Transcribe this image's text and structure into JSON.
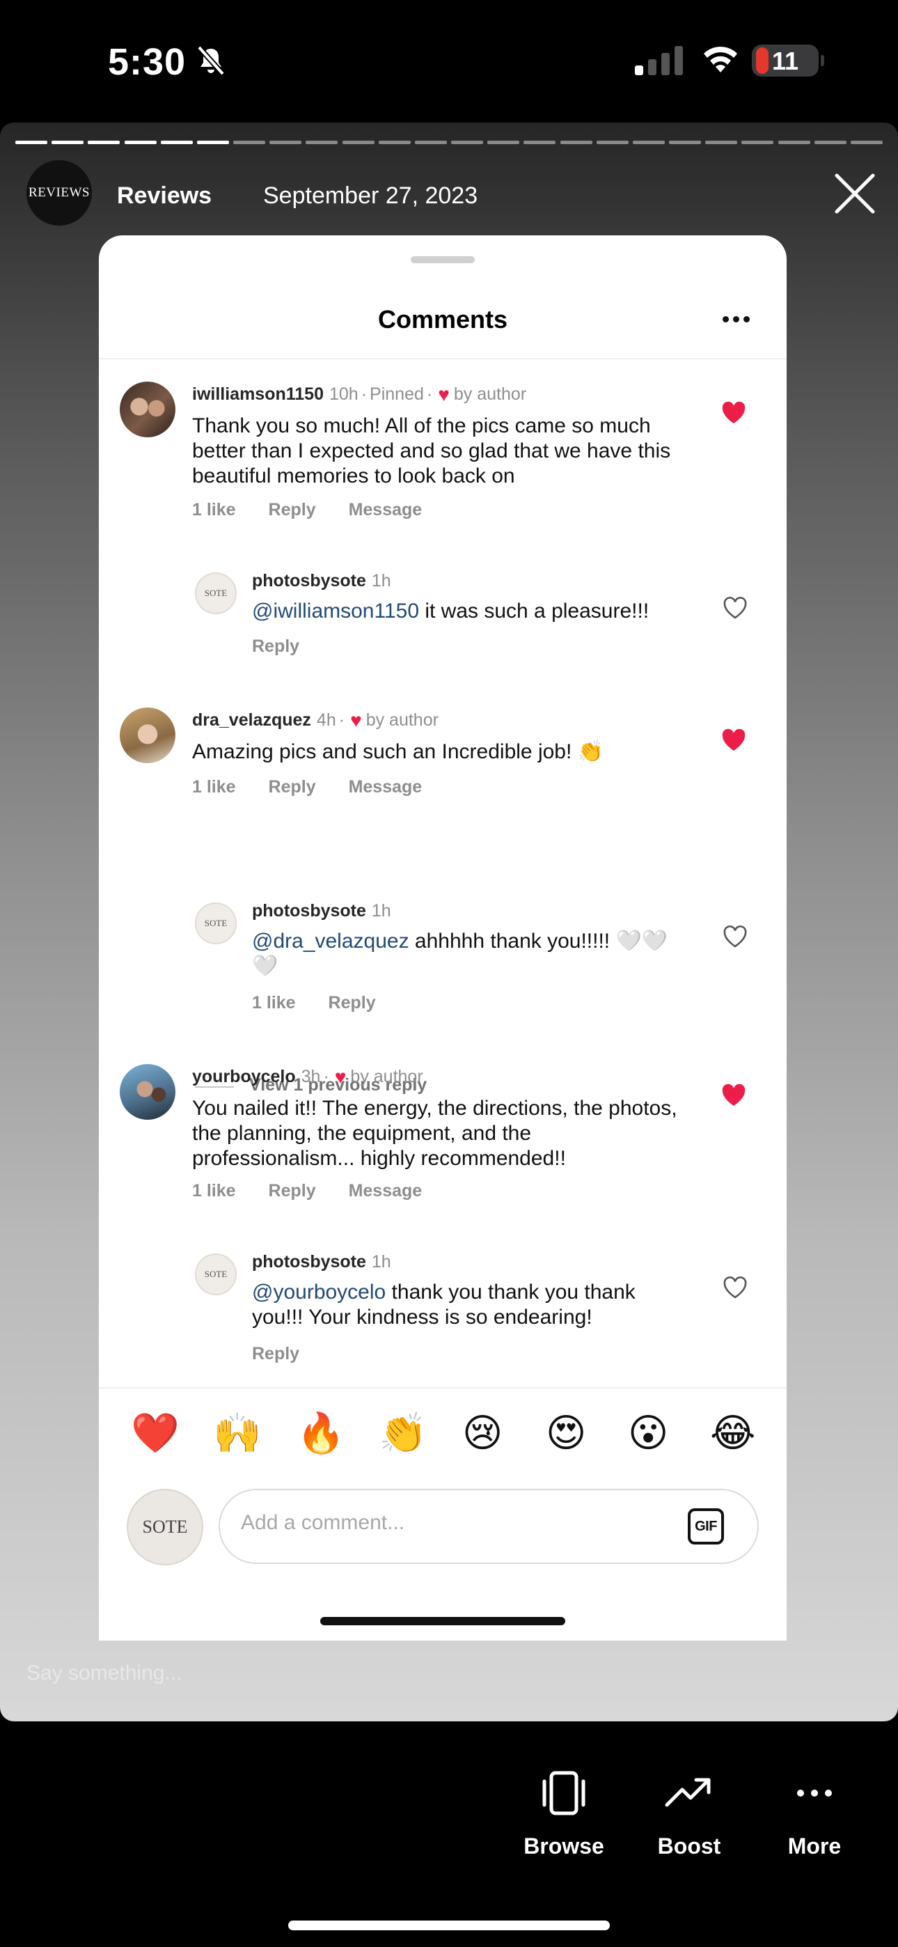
{
  "status_bar": {
    "time": "5:30",
    "battery": "11"
  },
  "story": {
    "account": "Reviews",
    "avatar_text": "REVIEWS",
    "overlay_date": "September 27, 2023",
    "reply_placeholder": "Say something..."
  },
  "comments_sheet": {
    "title": "Comments",
    "view_previous": "View 1 previous reply",
    "comments": [
      {
        "username": "iwilliamson1150",
        "time": "10h",
        "pinned": "Pinned",
        "by_author": "by author",
        "text": "Thank you so much! All of the pics came so much better than I expected  and so glad that we have this beautiful memories to look back on",
        "likes": "1 like",
        "reply": "Reply",
        "message": "Message"
      },
      {
        "username": "photosbysote",
        "time": "1h",
        "mention": "@iwilliamson1150",
        "text": " it was such a pleasure!!!",
        "reply": "Reply",
        "avatar_text": "SOTE"
      },
      {
        "username": "dra_velazquez",
        "time": "4h",
        "by_author": "by author",
        "text": "Amazing pics and such an Incredible job! 👏",
        "likes": "1 like",
        "reply": "Reply",
        "message": "Message"
      },
      {
        "username": "photosbysote",
        "time": "1h",
        "mention": "@dra_velazquez",
        "text": " ahhhhh thank you!!!!! 🤍🤍🤍",
        "likes": "1 like",
        "reply": "Reply",
        "avatar_text": "SOTE"
      },
      {
        "username": "yourboycelo",
        "time": "3h",
        "by_author": "by author",
        "text": "You nailed it!! The energy, the directions, the photos, the planning, the equipment, and the professionalism... highly recommended!!",
        "likes": "1 like",
        "reply": "Reply",
        "message": "Message"
      },
      {
        "username": "photosbysote",
        "time": "1h",
        "mention": "@yourboycelo",
        "text": " thank you thank you thank you!!! Your kindness is so endearing!",
        "reply": "Reply",
        "avatar_text": "SOTE"
      }
    ],
    "emoji_reactions": [
      "❤️",
      "🙌",
      "🔥",
      "👏",
      "😢",
      "😍",
      "😮",
      "😂"
    ],
    "composer": {
      "avatar_text": "SOTE",
      "placeholder": "Add a comment...",
      "gif_label": "GIF"
    }
  },
  "bottom_bar": {
    "browse": "Browse",
    "boost": "Boost",
    "more": "More"
  },
  "colors": {
    "heart": "#ed1d49",
    "mention": "#214a77",
    "muted": "#8e8e8e"
  }
}
